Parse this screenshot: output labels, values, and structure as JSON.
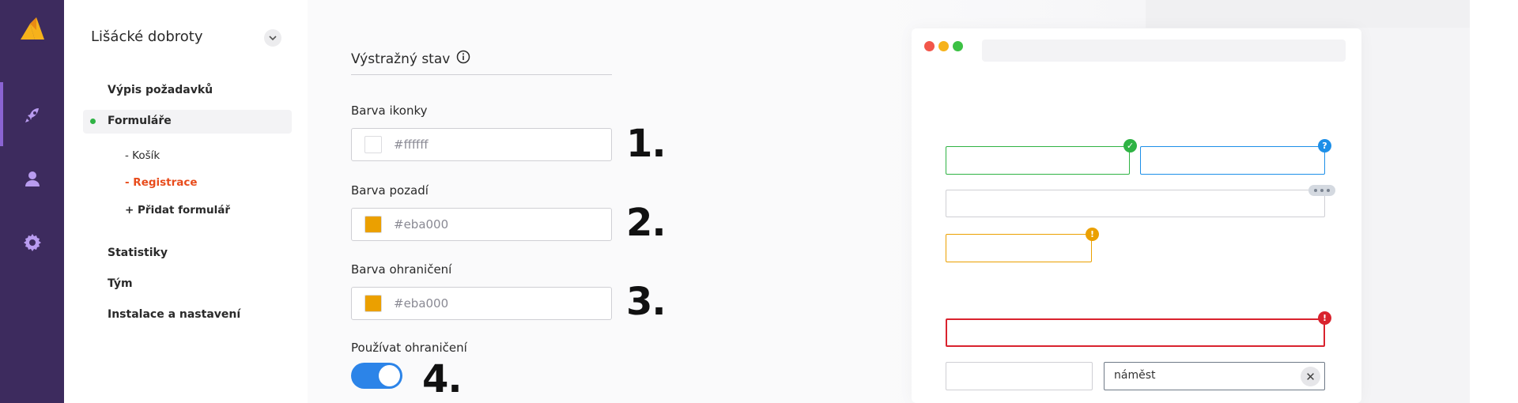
{
  "rail": {
    "icons": [
      "logo-icon",
      "rocket-icon",
      "user-icon",
      "gear-icon"
    ]
  },
  "nav": {
    "project_name": "Lišácké dobroty",
    "items": {
      "requests": "Výpis požadavků",
      "forms": "Formuláře",
      "statistics": "Statistiky",
      "team": "Tým",
      "install": "Instalace a nastavení"
    },
    "sub_items": {
      "cart": "- Košík",
      "registration": "- Registrace",
      "add_form": "+ Přidat formulář"
    }
  },
  "form": {
    "section_title": "Výstražný stav",
    "icon_color": {
      "label": "Barva ikonky",
      "value": "#ffffff",
      "swatch": "#ffffff",
      "number": "1."
    },
    "background_color": {
      "label": "Barva pozadí",
      "value": "#eba000",
      "swatch": "#eba000",
      "number": "2."
    },
    "border_color": {
      "label": "Barva ohraničení",
      "value": "#eba000",
      "swatch": "#eba000",
      "number": "3."
    },
    "use_border": {
      "label": "Používat ohraničení",
      "enabled": true,
      "number": "4."
    }
  },
  "preview": {
    "colors": {
      "success": "#2fb344",
      "info": "#1d8fe8",
      "warning": "#eba000",
      "error": "#d9232e"
    },
    "search_value": "náměst"
  }
}
